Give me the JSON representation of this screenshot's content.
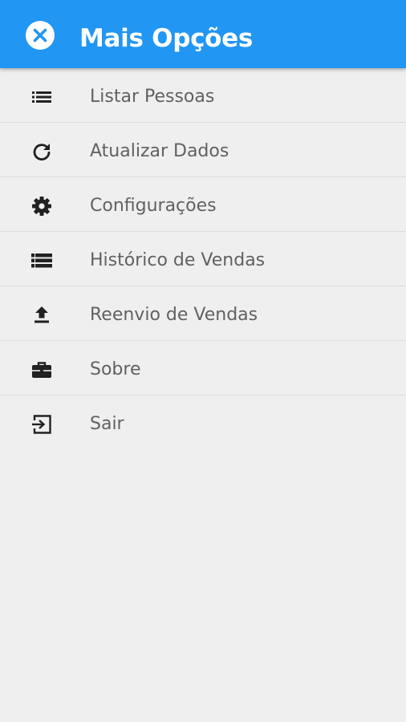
{
  "header": {
    "title": "Mais Opções",
    "close_icon": "close-circle-icon",
    "background_color": "#2196f3"
  },
  "menu": {
    "items": [
      {
        "label": "Listar Pessoas",
        "icon": "list-icon"
      },
      {
        "label": "Atualizar Dados",
        "icon": "refresh-icon"
      },
      {
        "label": "Configurações",
        "icon": "gear-icon"
      },
      {
        "label": "Histórico de Vendas",
        "icon": "view-list-icon"
      },
      {
        "label": "Reenvio de Vendas",
        "icon": "upload-icon"
      },
      {
        "label": "Sobre",
        "icon": "briefcase-icon"
      },
      {
        "label": "Sair",
        "icon": "exit-icon"
      }
    ]
  },
  "colors": {
    "accent": "#2196f3",
    "background": "#efefef",
    "text": "#616161",
    "icon": "#212121"
  }
}
